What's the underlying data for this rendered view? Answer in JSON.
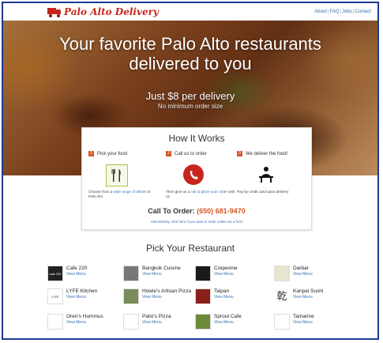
{
  "brand": {
    "name": "Palo Alto Delivery",
    "color": "#c7261e"
  },
  "nav": {
    "links": [
      "About",
      "FAQ",
      "Jobs",
      "Contact"
    ],
    "separator": "|"
  },
  "hero": {
    "title_line1": "Your favorite Palo Alto restaurants",
    "title_line2": "delivered to you",
    "price": "Just $8 per delivery",
    "subtitle": "No minimum order size"
  },
  "how": {
    "title": "How It Works",
    "steps": [
      {
        "num": "1",
        "label": "Pick your food",
        "desc_pre": "Choose from a ",
        "desc_link": "wide range of dishes",
        "desc_post": " in Palo Alto",
        "icon": "utensils-icon"
      },
      {
        "num": "2",
        "label": "Call us to order",
        "desc_pre": "Then give us a ",
        "desc_link": "call to place your order",
        "desc_post": " with us",
        "icon": "phone-icon"
      },
      {
        "num": "3",
        "label": "We deliver the food!",
        "desc_pre": "Pay by credit card upon delivery",
        "desc_link": "",
        "desc_post": "",
        "icon": "person-icon"
      }
    ],
    "call_label": "Call To Order:",
    "call_number": "(650) 681-9470",
    "alt_text": "Alternatively, click here if you want to order online via a form"
  },
  "pick": {
    "title": "Pick Your Restaurant",
    "view_menu": "View Menu"
  },
  "restaurants": [
    {
      "name": "Cafe 220",
      "thumb": "#222222",
      "thumb_text": "cafe 220"
    },
    {
      "name": "Bangkok Cuisine",
      "thumb": "#777777",
      "thumb_text": ""
    },
    {
      "name": "Crepevine",
      "thumb": "#1a1a1a",
      "thumb_text": ""
    },
    {
      "name": "Darbar",
      "thumb": "#e9e4cf",
      "thumb_text": ""
    },
    {
      "name": "LYFE Kitchen",
      "thumb": "#ffffff",
      "thumb_text": "LYFE"
    },
    {
      "name": "Howie's Artisan Pizza",
      "thumb": "#7a8c5a",
      "thumb_text": ""
    },
    {
      "name": "Taipan",
      "thumb": "#8a1f1a",
      "thumb_text": ""
    },
    {
      "name": "Kanpai Sushi",
      "thumb": "#ffffff",
      "thumb_text": "乾"
    },
    {
      "name": "Oren's Hummus",
      "thumb": "#ffffff",
      "thumb_text": ""
    },
    {
      "name": "Patxi's Pizza",
      "thumb": "#ffffff",
      "thumb_text": ""
    },
    {
      "name": "Sprout Cafe",
      "thumb": "#6a8a3a",
      "thumb_text": ""
    },
    {
      "name": "Tamarine",
      "thumb": "#ffffff",
      "thumb_text": ""
    }
  ]
}
